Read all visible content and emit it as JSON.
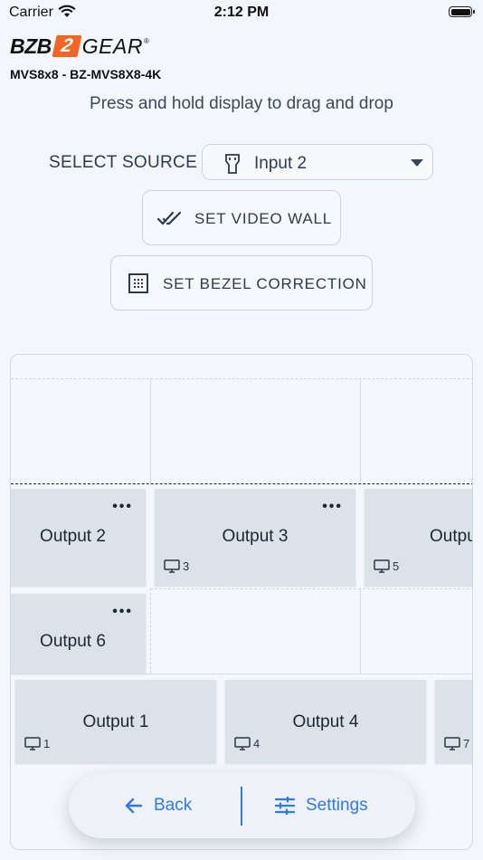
{
  "status_bar": {
    "carrier": "Carrier",
    "time": "2:12 PM"
  },
  "logo": {
    "left": "BZB",
    "mark": "2",
    "right": "GEAR",
    "reg": "®"
  },
  "device": {
    "model": "MVS8x8 - BZ-MVS8X8-4K"
  },
  "hint": "Press and hold display to drag and drop",
  "source": {
    "label": "SELECT SOURCE",
    "selected": "Input 2",
    "icon": "hdmi-plug-icon"
  },
  "buttons": {
    "video_wall": "SET VIDEO WALL",
    "bezel": "SET BEZEL CORRECTION"
  },
  "tiles": [
    {
      "name": "Output 2",
      "menu": "•••",
      "display": ""
    },
    {
      "name": "Output 3",
      "menu": "•••",
      "display": "3"
    },
    {
      "name": "Output",
      "menu": "",
      "display": "5"
    },
    {
      "name": "Output 6",
      "menu": "•••",
      "display": ""
    },
    {
      "name": "Output 1",
      "menu": "",
      "display": "1"
    },
    {
      "name": "Output 4",
      "menu": "",
      "display": "4"
    },
    {
      "name": "",
      "menu": "",
      "display": "7"
    }
  ],
  "nav": {
    "back": "Back",
    "settings": "Settings"
  },
  "colors": {
    "accent": "#2f7ae5",
    "brand_orange": "#f26522",
    "tile": "#dbe2ea"
  }
}
